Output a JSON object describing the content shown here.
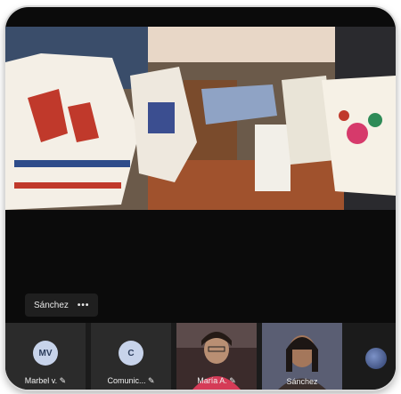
{
  "stage": {
    "active_speaker": "Sánchez",
    "more_label": "•••"
  },
  "participants": [
    {
      "initials": "MV",
      "name": "Marbel v. ✎",
      "avatar_color": "#c7d3ea"
    },
    {
      "initials": "C",
      "name": "Comunic... ✎",
      "avatar_color": "#c7d3ea"
    },
    {
      "initials": "",
      "name": "María A. ✎",
      "avatar_color": ""
    },
    {
      "initials": "",
      "name": "Sánchez",
      "avatar_color": ""
    }
  ],
  "colors": {
    "accent": "#7b83eb",
    "tile_bg": "#2b2b2b",
    "stage_bg": "#0b0b0b"
  }
}
